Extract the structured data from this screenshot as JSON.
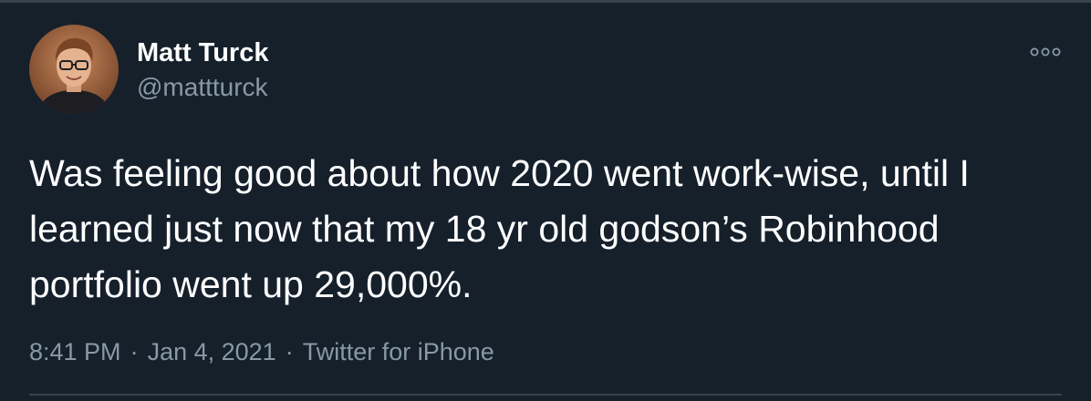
{
  "tweet": {
    "author": {
      "display_name": "Matt Turck",
      "handle": "@mattturck"
    },
    "text": "Was feeling good about how 2020 went work-wise, until I\nlearned just now that my 18 yr old godson’s Robinhood\nportfolio went up 29,000%.",
    "time": "8:41 PM",
    "date": "Jan 4, 2021",
    "source": "Twitter for iPhone",
    "separator": "·",
    "more_icon": "more-icon"
  },
  "colors": {
    "background": "#15202b",
    "text": "#ffffff",
    "secondary_text": "#8899a6",
    "divider": "#38444d"
  }
}
